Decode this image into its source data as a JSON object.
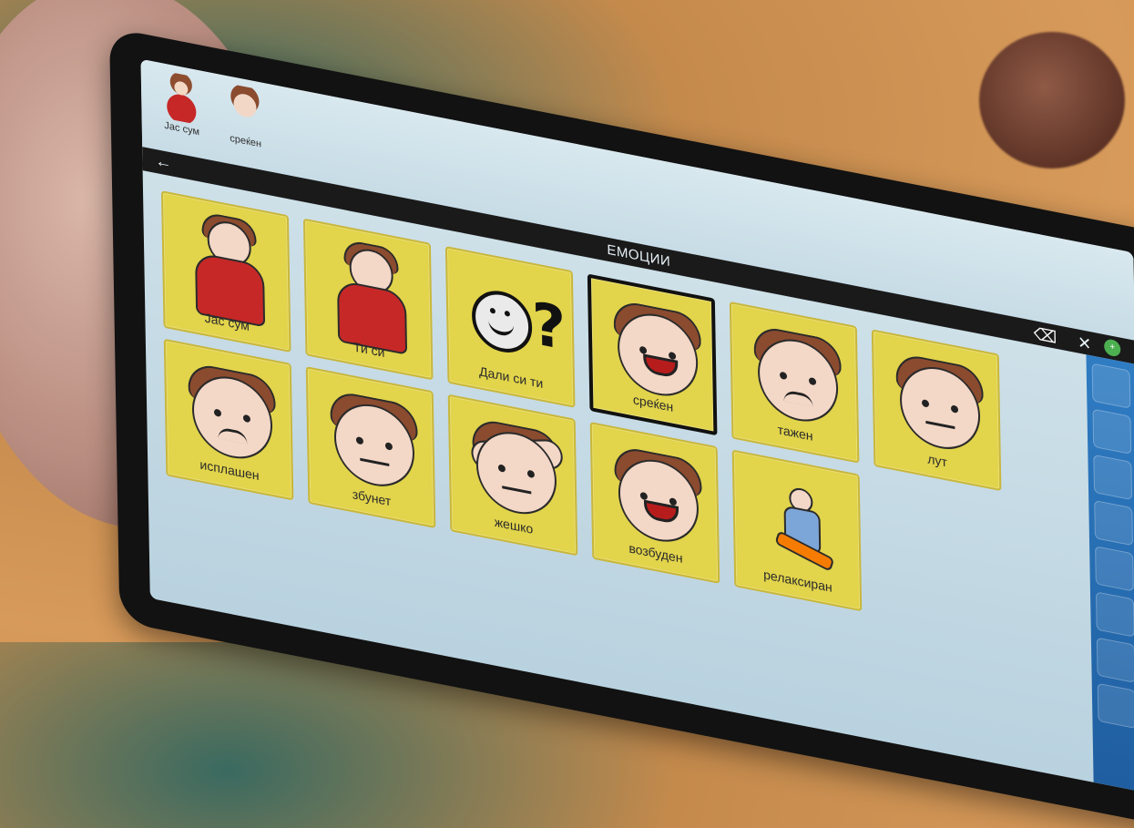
{
  "sentence": [
    {
      "label": "Јас сум",
      "pic": "girl"
    },
    {
      "label": "среќен",
      "pic": "boy"
    }
  ],
  "navbar": {
    "back_icon": "←",
    "title": "ЕМОЦИИ",
    "backspace_icon": "⌫",
    "close_icon": "✕"
  },
  "grid": [
    {
      "label": "Јас сум",
      "type": "girl"
    },
    {
      "label": "Ти си",
      "type": "girl"
    },
    {
      "label": "Дали си ти",
      "type": "question"
    },
    {
      "label": "среќен",
      "type": "boy",
      "mouth": "big",
      "selected": true
    },
    {
      "label": "тажен",
      "type": "boy",
      "mouth": "sad"
    },
    {
      "label": "лут",
      "type": "boy",
      "mouth": "flat"
    },
    {
      "label": "исплашен",
      "type": "boy",
      "mouth": "sad"
    },
    {
      "label": "збунет",
      "type": "boy",
      "mouth": "flat"
    },
    {
      "label": "жешко",
      "type": "hot"
    },
    {
      "label": "возбуден",
      "type": "boy",
      "mouth": "big"
    },
    {
      "label": "релаксиран",
      "type": "relax"
    }
  ]
}
